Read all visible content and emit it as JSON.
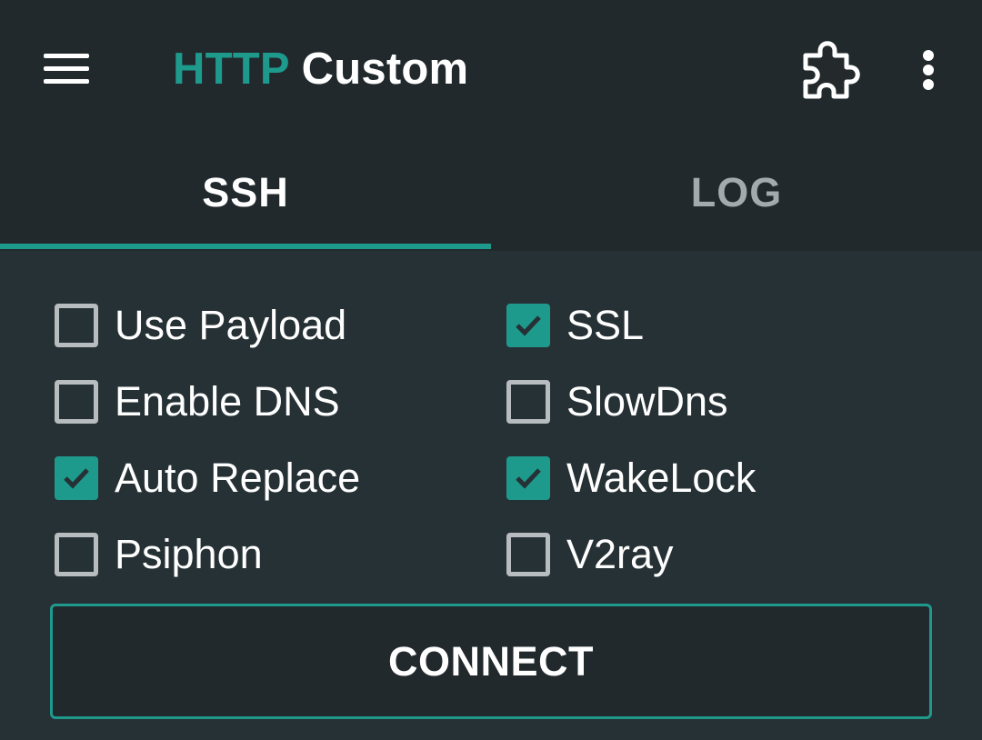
{
  "app": {
    "title_accent": "HTTP",
    "title_rest": " Custom"
  },
  "toolbar": {
    "menu_icon": "hamburger-icon",
    "extension_icon": "puzzle-piece-icon",
    "more_icon": "more-vert-icon"
  },
  "tabs": [
    {
      "label": "SSH",
      "selected": true
    },
    {
      "label": "LOG",
      "selected": false
    }
  ],
  "options": [
    {
      "label": "Use Payload",
      "checked": false
    },
    {
      "label": "SSL",
      "checked": true
    },
    {
      "label": "Enable DNS",
      "checked": false
    },
    {
      "label": "SlowDns",
      "checked": false
    },
    {
      "label": "Auto Replace",
      "checked": true
    },
    {
      "label": "WakeLock",
      "checked": true
    },
    {
      "label": "Psiphon",
      "checked": false
    },
    {
      "label": "V2ray",
      "checked": false
    }
  ],
  "connect_button": {
    "label": "CONNECT"
  },
  "colors": {
    "accent": "#1e9a8d",
    "app_bar": "#21292d",
    "background": "#263135",
    "inactive_tab": "#a3aaae"
  }
}
